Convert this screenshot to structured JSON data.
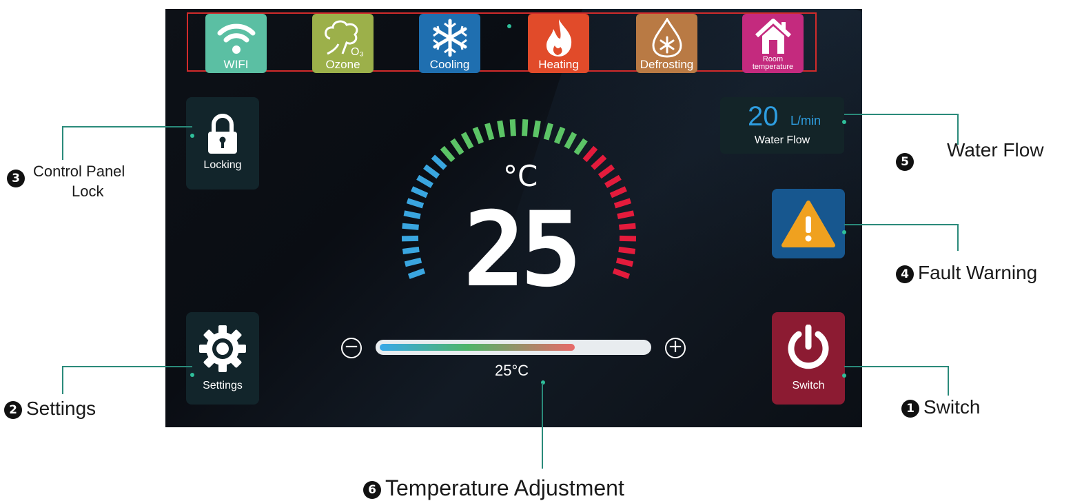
{
  "modes": [
    {
      "label": "WIFI",
      "icon": "wifi-icon",
      "color": "#5bbfa3"
    },
    {
      "label": "Ozone",
      "icon": "ozone-icon",
      "color": "#9cb04a"
    },
    {
      "label": "Cooling",
      "icon": "snowflake-icon",
      "color": "#1f6fb0"
    },
    {
      "label": "Heating",
      "icon": "flame-icon",
      "color": "#e14b2a"
    },
    {
      "label": "Defrosting",
      "icon": "drop-snowflake-icon",
      "color": "#b97a44"
    },
    {
      "label": "Room temperature",
      "label_line1": "Room",
      "label_line2": "temperature",
      "icon": "house-icon",
      "color": "#c42a7e"
    }
  ],
  "locking": {
    "label": "Locking",
    "icon": "padlock-icon"
  },
  "settings": {
    "label": "Settings",
    "icon": "gear-icon"
  },
  "water_flow": {
    "value": "20",
    "unit": "L/min",
    "label": "Water Flow"
  },
  "fault": {
    "icon": "warning-triangle-icon",
    "color": "#f0a11f"
  },
  "switch": {
    "label": "Switch",
    "icon": "power-icon"
  },
  "temperature": {
    "current": "25",
    "unit": "°C",
    "setpoint_text": "25°C",
    "slider_fraction": 0.73
  },
  "annotations": {
    "lock": {
      "number": "3",
      "line1": "Control Panel",
      "line2": "Lock"
    },
    "settings": {
      "number": "2",
      "text": "Settings"
    },
    "water_flow": {
      "number": "5",
      "text": "Water Flow"
    },
    "fault": {
      "number": "4",
      "text": "Fault Warning"
    },
    "switch": {
      "number": "1",
      "text": "Switch"
    },
    "temp_adjust": {
      "number": "6",
      "text": "Temperature Adjustment"
    }
  },
  "colors": {
    "callout_line": "#2a8a7a",
    "gauge_cold": "#3aa6e0",
    "gauge_mid": "#5cc466",
    "gauge_hot": "#e41b3c"
  }
}
